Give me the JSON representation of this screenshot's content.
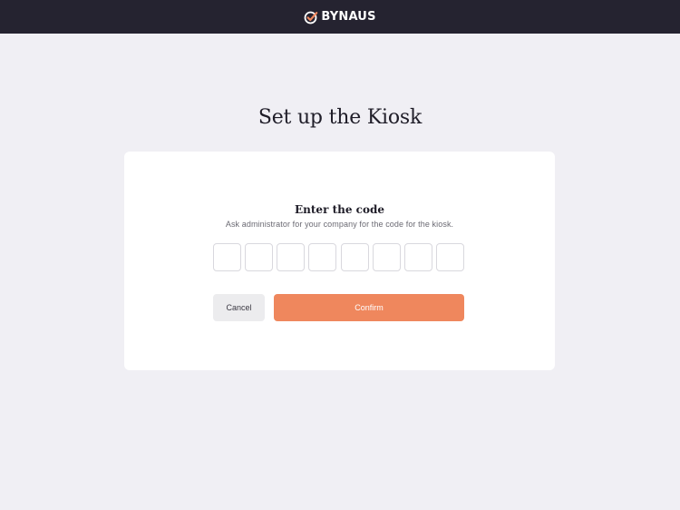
{
  "header": {
    "brand_name": "BYNAUS",
    "logo_icon": "check-circle-icon",
    "background_color": "#252330"
  },
  "page": {
    "title": "Set up the Kiosk",
    "background_color": "#f0eff4"
  },
  "card": {
    "title": "Enter the code",
    "subtitle": "Ask administrator for your company for the code for the kiosk.",
    "code_digits": [
      "",
      "",
      "",
      "",
      "",
      "",
      "",
      ""
    ]
  },
  "actions": {
    "cancel_label": "Cancel",
    "confirm_label": "Confirm",
    "accent_color": "#ef875d"
  }
}
